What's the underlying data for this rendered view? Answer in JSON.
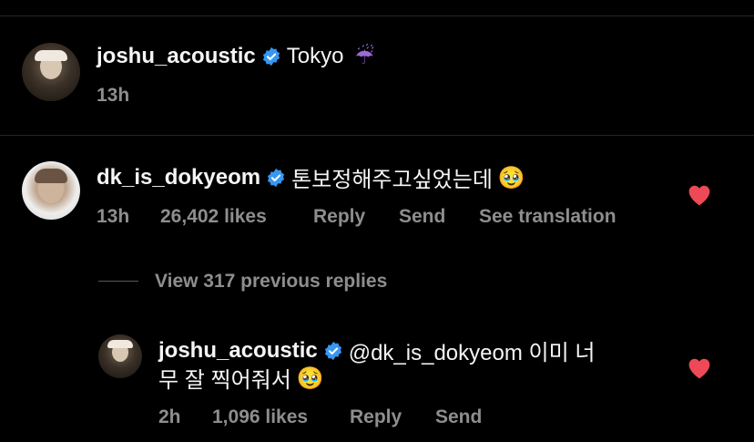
{
  "post": {
    "username": "joshu_acoustic",
    "caption": "Tokyo",
    "caption_emoji": "☔",
    "time": "13h"
  },
  "comment": {
    "username": "dk_is_dokyeom",
    "text": "톤보정해주고싶었는데",
    "emoji": "🥹",
    "time": "13h",
    "likes": "26,402 likes",
    "reply_label": "Reply",
    "send_label": "Send",
    "translate_label": "See translation"
  },
  "view_replies": {
    "label": "View 317 previous replies"
  },
  "reply": {
    "username": "joshu_acoustic",
    "line1": "@dk_is_dokyeom 이미 너",
    "line2": "무 잘 찍어줘서",
    "emoji": "🥹",
    "time": "2h",
    "likes": "1,096 likes",
    "reply_label": "Reply",
    "send_label": "Send"
  },
  "colors": {
    "background": "#000000",
    "verified_badge": "#3897f0",
    "like_heart": "#ed4956",
    "secondary_text": "#8e8e8e"
  },
  "icons": [
    "verified-badge-icon",
    "heart-icon",
    "umbrella-emoji"
  ]
}
